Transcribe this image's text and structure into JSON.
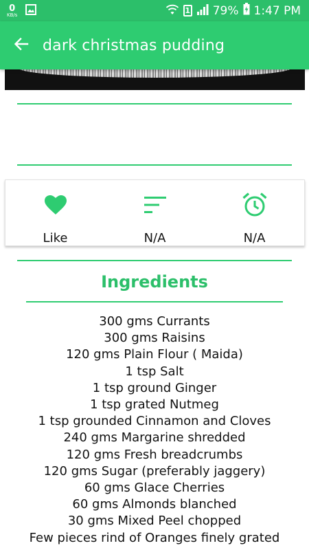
{
  "status_bar": {
    "net_speed": "0",
    "net_speed_unit": "KB/s",
    "sim": "1",
    "battery": "79%",
    "time": "1:47 PM"
  },
  "app_bar": {
    "back_icon": "arrow-back-icon",
    "title": "dark christmas pudding"
  },
  "actions": [
    {
      "icon": "heart-icon",
      "label": "Like"
    },
    {
      "icon": "sort-lines-icon",
      "label": "N/A"
    },
    {
      "icon": "alarm-clock-icon",
      "label": "N/A"
    }
  ],
  "ingredients": {
    "title": "Ingredients",
    "items": [
      "300 gms Currants",
      "300 gms Raisins",
      "120 gms Plain Flour ( Maida)",
      "1 tsp Salt",
      "1 tsp ground Ginger",
      "1 tsp grated Nutmeg",
      "1 tsp grounded Cinnamon and Cloves",
      "240 gms Margarine shredded",
      "120 gms Fresh breadcrumbs",
      "120 gms Sugar (preferably jaggery)",
      "60 gms Glace Cherries",
      "60 gms Almonds blanched",
      "30 gms Mixed Peel chopped",
      "Few pieces rind of Oranges finely grated"
    ]
  },
  "colors": {
    "accent": "#2ecc71",
    "status_bar": "#2cbf6a"
  }
}
